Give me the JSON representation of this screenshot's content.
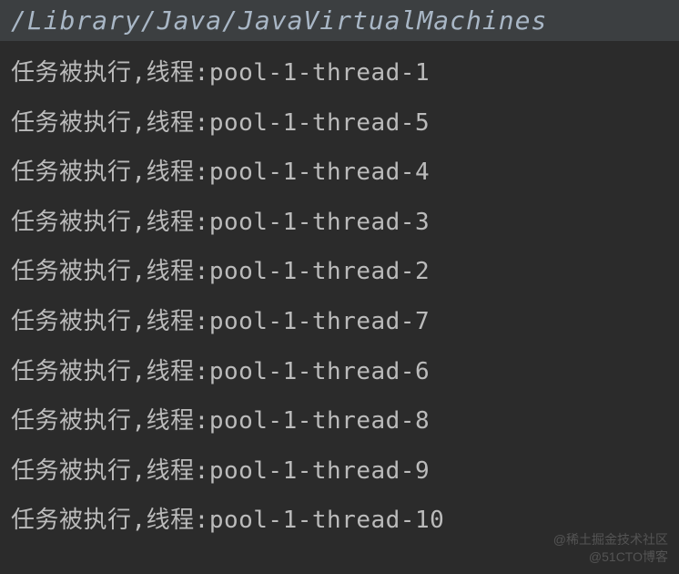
{
  "header": {
    "path": "/Library/Java/JavaVirtualMachines"
  },
  "console": {
    "lines": [
      {
        "prefix": "任务被执行,线程:",
        "thread": "pool-1-thread-1"
      },
      {
        "prefix": "任务被执行,线程:",
        "thread": "pool-1-thread-5"
      },
      {
        "prefix": "任务被执行,线程:",
        "thread": "pool-1-thread-4"
      },
      {
        "prefix": "任务被执行,线程:",
        "thread": "pool-1-thread-3"
      },
      {
        "prefix": "任务被执行,线程:",
        "thread": "pool-1-thread-2"
      },
      {
        "prefix": "任务被执行,线程:",
        "thread": "pool-1-thread-7"
      },
      {
        "prefix": "任务被执行,线程:",
        "thread": "pool-1-thread-6"
      },
      {
        "prefix": "任务被执行,线程:",
        "thread": "pool-1-thread-8"
      },
      {
        "prefix": "任务被执行,线程:",
        "thread": "pool-1-thread-9"
      },
      {
        "prefix": "任务被执行,线程:",
        "thread": "pool-1-thread-10"
      }
    ]
  },
  "watermark": {
    "line1": "@稀土掘金技术社区",
    "line2": "@51CTO博客"
  }
}
